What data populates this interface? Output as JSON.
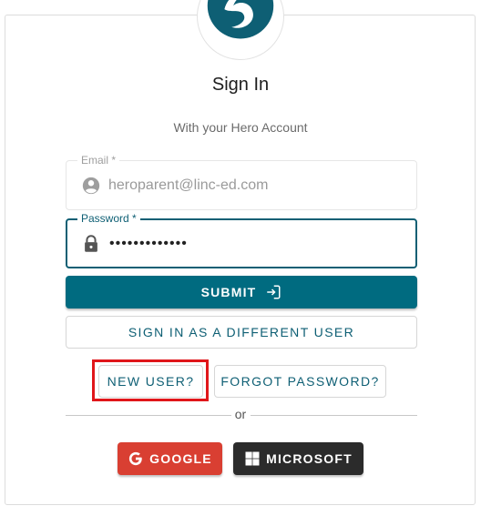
{
  "header": {
    "title": "Sign In",
    "subtitle": "With your Hero Account"
  },
  "form": {
    "email": {
      "label": "Email *",
      "value": "heroparent@linc-ed.com",
      "icon": "account-circle-icon"
    },
    "password": {
      "label": "Password *",
      "value": "•••••••••••••",
      "icon": "lock-icon"
    }
  },
  "actions": {
    "submit_label": "SUBMIT",
    "different_user_label": "SIGN IN AS A DIFFERENT USER",
    "new_user_label": "NEW USER?",
    "forgot_password_label": "FORGOT PASSWORD?"
  },
  "divider": {
    "text": "or"
  },
  "social": {
    "google_label": "GOOGLE",
    "microsoft_label": "MICROSOFT"
  },
  "colors": {
    "primary": "#006b80",
    "google": "#d93f32",
    "microsoft": "#2b2b2b",
    "highlight": "#e0161a"
  }
}
